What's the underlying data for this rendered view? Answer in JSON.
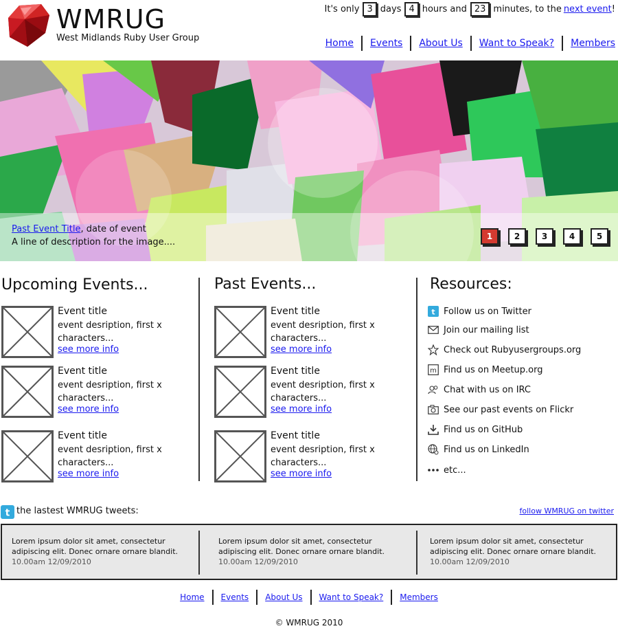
{
  "header": {
    "site_name": "WMRUG",
    "site_subtitle": "West Midlands Ruby User Group",
    "countdown": {
      "prefix": "It's only",
      "days_value": "3",
      "days_label": "days",
      "hours_value": "4",
      "hours_label": "hours and",
      "minutes_value": "23",
      "minutes_label": "minutes, to the",
      "link": "next event",
      "suffix": "!"
    },
    "nav": [
      "Home",
      "Events",
      "About Us",
      "Want to Speak?",
      "Members"
    ]
  },
  "banner": {
    "caption_link": "Past Event Title",
    "caption_rest": ", date of event",
    "caption_desc": "A line of description for the image....",
    "pages": [
      "1",
      "2",
      "3",
      "4",
      "5"
    ],
    "active_page": "1",
    "active_color": "#d43a30"
  },
  "upcoming": {
    "title": "Upcoming Events...",
    "events": [
      {
        "title": "Event title",
        "desc": "event desription, first x characters...",
        "more": "see more info"
      },
      {
        "title": "Event title",
        "desc": "event desription, first x characters...",
        "more": "see more info"
      },
      {
        "title": "Event title",
        "desc": "event desription, first x characters...",
        "more": "see more info"
      }
    ]
  },
  "past": {
    "title": "Past Events...",
    "events": [
      {
        "title": "Event title",
        "desc": "event desription, first x characters...",
        "more": "see more info"
      },
      {
        "title": "Event title",
        "desc": "event desription, first x characters...",
        "more": "see more info"
      },
      {
        "title": "Event title",
        "desc": "event desription, first x characters...",
        "more": "see more info"
      }
    ]
  },
  "resources": {
    "title": "Resources:",
    "items": [
      {
        "label": "Follow us on Twitter",
        "icon": "twitter-icon"
      },
      {
        "label": "Join our mailing list",
        "icon": "mail-icon"
      },
      {
        "label": "Check out Rubyusergroups.org",
        "icon": "star-icon"
      },
      {
        "label": "Find us on Meetup.org",
        "icon": "meetup-icon"
      },
      {
        "label": "Chat with us on IRC",
        "icon": "chat-icon"
      },
      {
        "label": "See our past events on Flickr",
        "icon": "camera-icon"
      },
      {
        "label": "Find us on GitHub",
        "icon": "download-icon"
      },
      {
        "label": "Find us on LinkedIn",
        "icon": "globe-icon"
      },
      {
        "label": "etc...",
        "icon": "ellipsis-icon"
      }
    ]
  },
  "tweets": {
    "label": "the lastest WMRUG tweets:",
    "follow_link": "follow WMRUG on twitter",
    "items": [
      {
        "text": "Lorem ipsum dolor sit amet, consectetur adipiscing elit. Donec ornare ornare blandit.",
        "time": "10.00am 12/09/2010"
      },
      {
        "text": "Lorem ipsum dolor sit amet, consectetur adipiscing elit. Donec ornare ornare blandit.",
        "time": "10.00am 12/09/2010"
      },
      {
        "text": "Lorem ipsum dolor sit amet, consectetur adipiscing elit. Donec ornare ornare blandit.",
        "time": "10.00am 12/09/2010"
      }
    ]
  },
  "footer": {
    "nav": [
      "Home",
      "Events",
      "About Us",
      "Want to Speak?",
      "Members"
    ],
    "copyright": "© WMRUG 2010"
  }
}
